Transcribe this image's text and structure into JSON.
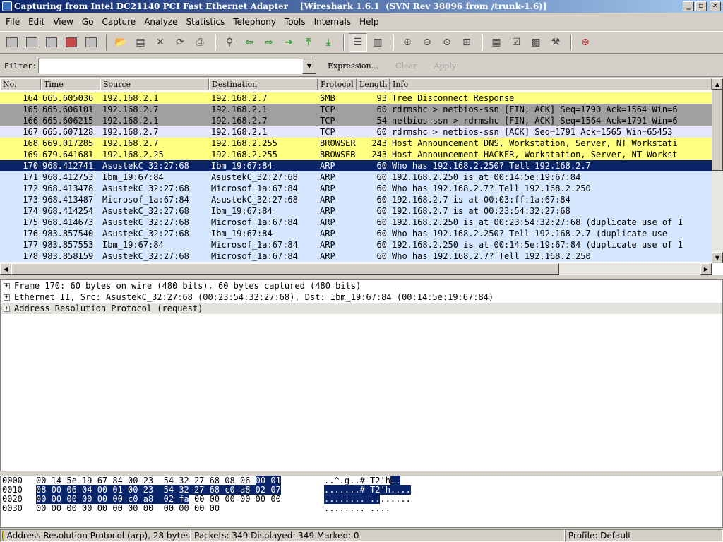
{
  "window": {
    "title": "Capturing from Intel DC21140 PCI Fast Ethernet Adapter    [Wireshark 1.6.1  (SVN Rev 38096 from /trunk-1.6)]"
  },
  "menu": [
    "File",
    "Edit",
    "View",
    "Go",
    "Capture",
    "Analyze",
    "Statistics",
    "Telephony",
    "Tools",
    "Internals",
    "Help"
  ],
  "filter": {
    "label": "Filter:",
    "value": "",
    "expression_label": "Expression...",
    "clear_label": "Clear",
    "apply_label": "Apply"
  },
  "columns": [
    "No.",
    "Time",
    "Source",
    "Destination",
    "Protocol",
    "Length",
    "Info"
  ],
  "colors": {
    "smb_bg": "#ffff80",
    "tcp_bg": "#a0a0a0",
    "tcp_light_bg": "#e7e6ff",
    "arp_bg": "#d6e8ff",
    "selected_bg": "#0a246a"
  },
  "packets": [
    {
      "no": "164",
      "time": "665.605036",
      "src": "192.168.2.1",
      "dst": "192.168.2.7",
      "proto": "SMB",
      "len": "93",
      "info": "Tree Disconnect Response",
      "color": "#ffff80",
      "fg": "#000000"
    },
    {
      "no": "165",
      "time": "665.606101",
      "src": "192.168.2.7",
      "dst": "192.168.2.1",
      "proto": "TCP",
      "len": "60",
      "info": "rdrmshc > netbios-ssn [FIN, ACK] Seq=1790 Ack=1564 Win=6",
      "color": "#a0a0a0",
      "fg": "#000000"
    },
    {
      "no": "166",
      "time": "665.606215",
      "src": "192.168.2.1",
      "dst": "192.168.2.7",
      "proto": "TCP",
      "len": "54",
      "info": "netbios-ssn > rdrmshc [FIN, ACK] Seq=1564 Ack=1791 Win=6",
      "color": "#a0a0a0",
      "fg": "#000000"
    },
    {
      "no": "167",
      "time": "665.607128",
      "src": "192.168.2.7",
      "dst": "192.168.2.1",
      "proto": "TCP",
      "len": "60",
      "info": "rdrmshc > netbios-ssn [ACK] Seq=1791 Ack=1565 Win=65453",
      "color": "#e7e6ff",
      "fg": "#000000"
    },
    {
      "no": "168",
      "time": "669.017285",
      "src": "192.168.2.7",
      "dst": "192.168.2.255",
      "proto": "BROWSER",
      "len": "243",
      "info": "Host Announcement DNS, Workstation, Server, NT Workstati",
      "color": "#ffff80",
      "fg": "#000000"
    },
    {
      "no": "169",
      "time": "679.641681",
      "src": "192.168.2.25",
      "dst": "192.168.2.255",
      "proto": "BROWSER",
      "len": "243",
      "info": "Host Announcement HACKER, Workstation, Server, NT Workst",
      "color": "#ffff80",
      "fg": "#000000"
    },
    {
      "no": "170",
      "time": "968.412741",
      "src": "AsustekC_32:27:68",
      "dst": "Ibm_19:67:84",
      "proto": "ARP",
      "len": "60",
      "info": "Who has 192.168.2.250?  Tell 192.168.2.7",
      "color": "#0a246a",
      "fg": "#ffffff"
    },
    {
      "no": "171",
      "time": "968.412753",
      "src": "Ibm_19:67:84",
      "dst": "AsustekC_32:27:68",
      "proto": "ARP",
      "len": "60",
      "info": "192.168.2.250 is at 00:14:5e:19:67:84",
      "color": "#d6e8ff",
      "fg": "#000000"
    },
    {
      "no": "172",
      "time": "968.413478",
      "src": "AsustekC_32:27:68",
      "dst": "Microsof_1a:67:84",
      "proto": "ARP",
      "len": "60",
      "info": "Who has 192.168.2.7?  Tell 192.168.2.250",
      "color": "#d6e8ff",
      "fg": "#000000"
    },
    {
      "no": "173",
      "time": "968.413487",
      "src": "Microsof_1a:67:84",
      "dst": "AsustekC_32:27:68",
      "proto": "ARP",
      "len": "60",
      "info": "192.168.2.7 is at 00:03:ff:1a:67:84",
      "color": "#d6e8ff",
      "fg": "#000000"
    },
    {
      "no": "174",
      "time": "968.414254",
      "src": "AsustekC_32:27:68",
      "dst": "Ibm_19:67:84",
      "proto": "ARP",
      "len": "60",
      "info": "192.168.2.7 is at 00:23:54:32:27:68",
      "color": "#d6e8ff",
      "fg": "#000000"
    },
    {
      "no": "175",
      "time": "968.414673",
      "src": "AsustekC_32:27:68",
      "dst": "Microsof_1a:67:84",
      "proto": "ARP",
      "len": "60",
      "info": "192.168.2.250 is at 00:23:54:32:27:68 (duplicate use of 1",
      "color": "#d6e8ff",
      "fg": "#000000"
    },
    {
      "no": "176",
      "time": "983.857540",
      "src": "AsustekC_32:27:68",
      "dst": "Ibm_19:67:84",
      "proto": "ARP",
      "len": "60",
      "info": "Who has 192.168.2.250?  Tell 192.168.2.7 (duplicate use",
      "color": "#d6e8ff",
      "fg": "#000000"
    },
    {
      "no": "177",
      "time": "983.857553",
      "src": "Ibm_19:67:84",
      "dst": "Microsof_1a:67:84",
      "proto": "ARP",
      "len": "60",
      "info": "192.168.2.250 is at 00:14:5e:19:67:84 (duplicate use of 1",
      "color": "#d6e8ff",
      "fg": "#000000"
    },
    {
      "no": "178",
      "time": "983.858159",
      "src": "AsustekC_32:27:68",
      "dst": "Microsof_1a:67:84",
      "proto": "ARP",
      "len": "60",
      "info": "Who has 192.168.2.7?  Tell 192.168.2.250",
      "color": "#d6e8ff",
      "fg": "#000000"
    }
  ],
  "details": [
    {
      "label": "Frame 170: 60 bytes on wire (480 bits), 60 bytes captured (480 bits)",
      "selected": false
    },
    {
      "label": "Ethernet II, Src: AsustekC_32:27:68 (00:23:54:32:27:68), Dst: Ibm_19:67:84 (00:14:5e:19:67:84)",
      "selected": false
    },
    {
      "label": "Address Resolution Protocol (request)",
      "selected": true
    }
  ],
  "bytes": [
    {
      "offset": "0000",
      "hex_pre": "00 14 5e 19 67 84 00 23  54 32 27 68 08 06 ",
      "hex_hl": "00 01",
      "hex_post": "",
      "ascii_pre": "..^.g..# T2'h",
      "ascii_hl": "..",
      "ascii_post": ""
    },
    {
      "offset": "0010",
      "hex_pre": "",
      "hex_hl": "08 00 06 04 00 01 00 23  54 32 27 68 c0 a8 02 07",
      "hex_post": "",
      "ascii_pre": "",
      "ascii_hl": ".......# T2'h....",
      "ascii_post": ""
    },
    {
      "offset": "0020",
      "hex_pre": "",
      "hex_hl": "00 00 00 00 00 00 c0 a8  02 fa",
      "hex_post": " 00 00 00 00 00 00",
      "ascii_pre": "",
      "ascii_hl": "........ ..",
      "ascii_post": "......"
    },
    {
      "offset": "0030",
      "hex_pre": "00 00 00 00 00 00 00 00  00 00 00 00",
      "hex_hl": "",
      "hex_post": "",
      "ascii_pre": "........ ....",
      "ascii_hl": "",
      "ascii_post": ""
    }
  ],
  "status": {
    "protocol_info": "Address Resolution Protocol (arp), 28 bytes",
    "packets_info": "Packets: 349 Displayed: 349 Marked: 0",
    "profile": "Profile: Default"
  }
}
